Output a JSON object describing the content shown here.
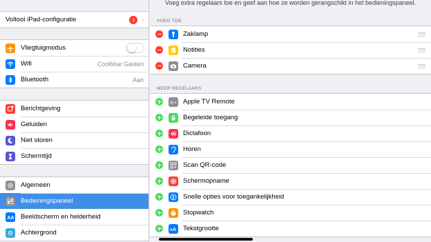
{
  "sidebar": {
    "setup": {
      "label": "Voltooi iPad-configuratie",
      "badge": "1"
    },
    "connectivity": [
      {
        "label": "Vliegtuigmodus",
        "value": "",
        "icon": "airplane-icon",
        "color": "#ff9500"
      },
      {
        "label": "Wifi",
        "value": "Coolblue Gasten",
        "icon": "wifi-icon",
        "color": "#007aff"
      },
      {
        "label": "Bluetooth",
        "value": "Aan",
        "icon": "bluetooth-icon",
        "color": "#007aff"
      }
    ],
    "notifications": [
      {
        "label": "Berichtgeving",
        "icon": "notifications-icon",
        "color": "#ff3b30"
      },
      {
        "label": "Geluiden",
        "icon": "sounds-icon",
        "color": "#ff2d55"
      },
      {
        "label": "Niet storen",
        "icon": "moon-icon",
        "color": "#5856d6"
      },
      {
        "label": "Schermtijd",
        "icon": "hourglass-icon",
        "color": "#5856d6"
      }
    ],
    "general": [
      {
        "label": "Algemeen",
        "icon": "gear-icon",
        "color": "#8e8e93"
      },
      {
        "label": "Bedieningspaneel",
        "icon": "control-center-icon",
        "color": "#8e8e93",
        "selected": true
      },
      {
        "label": "Beeldscherm en helderheid",
        "icon": "display-icon",
        "color": "#007aff"
      },
      {
        "label": "Achtergrond",
        "icon": "wallpaper-icon",
        "color": "#34aadc"
      }
    ]
  },
  "main": {
    "description": "Voeg extra regelaars toe en geef aan hoe ze worden gerangschikt in het bedieningspaneel.",
    "include_header": "VOEG TOE",
    "included": [
      {
        "label": "Zaklamp",
        "icon": "flashlight-icon",
        "color": "#007aff"
      },
      {
        "label": "Notities",
        "icon": "notes-icon",
        "color": "#ffcc00"
      },
      {
        "label": "Camera",
        "icon": "camera-icon",
        "color": "#8e8e93"
      }
    ],
    "more_header": "MEER REGELAARS",
    "more": [
      {
        "label": "Apple TV Remote",
        "icon": "tv-remote-icon",
        "color": "#8e8e93"
      },
      {
        "label": "Begeleide toegang",
        "icon": "lock-icon",
        "color": "#4cd964"
      },
      {
        "label": "Dictafoon",
        "icon": "voice-memo-icon",
        "color": "#ff2d55"
      },
      {
        "label": "Horen",
        "icon": "ear-icon",
        "color": "#007aff"
      },
      {
        "label": "Scan QR-code",
        "icon": "qr-code-icon",
        "color": "#8e8e93"
      },
      {
        "label": "Schermopname",
        "icon": "screen-record-icon",
        "color": "#ff3b30"
      },
      {
        "label": "Snelle opties voor toegankelijkheid",
        "icon": "accessibility-icon",
        "color": "#007aff"
      },
      {
        "label": "Stopwatch",
        "icon": "stopwatch-icon",
        "color": "#ff9500"
      },
      {
        "label": "Tekstgrootte",
        "icon": "text-size-icon",
        "color": "#007aff"
      }
    ]
  }
}
